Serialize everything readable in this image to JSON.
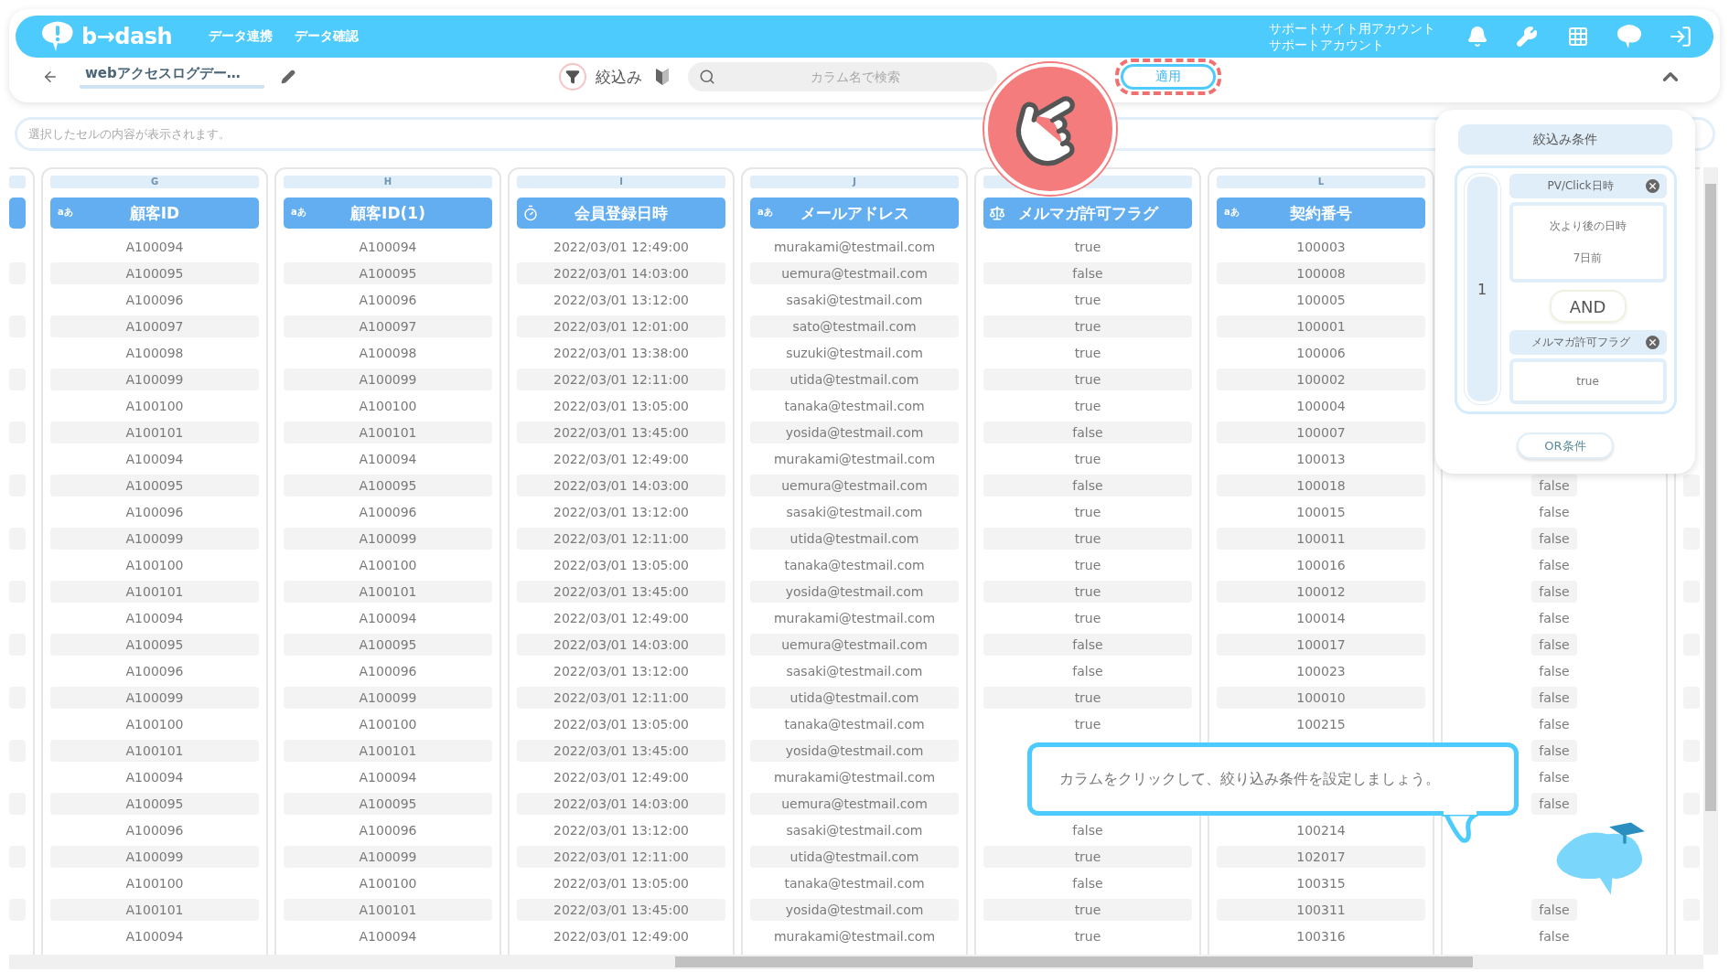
{
  "header": {
    "logo": "b→dash",
    "nav": [
      "データ連携",
      "データ確認"
    ],
    "account": [
      "サポートサイト用アカウント",
      "サポートアカウント"
    ]
  },
  "toolbar": {
    "title": "webアクセスログデー…",
    "filter_label": "絞込み",
    "search": {
      "placeholder": "カラム名で検索"
    },
    "apply_button": "適用"
  },
  "cell_viewer": {
    "placeholder": "選択したセルの内容が表示されます。"
  },
  "table": {
    "columns": [
      {
        "letter": "G",
        "kind": "text",
        "type_label": "aあ",
        "title": "顧客ID",
        "cells": [
          "A100094",
          "A100095",
          "A100096",
          "A100097",
          "A100098",
          "A100099",
          "A100100",
          "A100101",
          "A100094",
          "A100095",
          "A100096",
          "A100099",
          "A100100",
          "A100101",
          "A100094",
          "A100095",
          "A100096",
          "A100099",
          "A100100",
          "A100101",
          "A100094",
          "A100095",
          "A100096",
          "A100099",
          "A100100",
          "A100101",
          "A100094"
        ]
      },
      {
        "letter": "H",
        "kind": "text",
        "type_label": "aあ",
        "title": "顧客ID(1)",
        "cells": [
          "A100094",
          "A100095",
          "A100096",
          "A100097",
          "A100098",
          "A100099",
          "A100100",
          "A100101",
          "A100094",
          "A100095",
          "A100096",
          "A100099",
          "A100100",
          "A100101",
          "A100094",
          "A100095",
          "A100096",
          "A100099",
          "A100100",
          "A100101",
          "A100094",
          "A100095",
          "A100096",
          "A100099",
          "A100100",
          "A100101",
          "A100094"
        ]
      },
      {
        "letter": "I",
        "kind": "datetime",
        "title": "会員登録日時",
        "cells": [
          "2022/03/01 12:49:00",
          "2022/03/01 14:03:00",
          "2022/03/01 13:12:00",
          "2022/03/01 12:01:00",
          "2022/03/01 13:38:00",
          "2022/03/01 12:11:00",
          "2022/03/01 13:05:00",
          "2022/03/01 13:45:00",
          "2022/03/01 12:49:00",
          "2022/03/01 14:03:00",
          "2022/03/01 13:12:00",
          "2022/03/01 12:11:00",
          "2022/03/01 13:05:00",
          "2022/03/01 13:45:00",
          "2022/03/01 12:49:00",
          "2022/03/01 14:03:00",
          "2022/03/01 13:12:00",
          "2022/03/01 12:11:00",
          "2022/03/01 13:05:00",
          "2022/03/01 13:45:00",
          "2022/03/01 12:49:00",
          "2022/03/01 14:03:00",
          "2022/03/01 13:12:00",
          "2022/03/01 12:11:00",
          "2022/03/01 13:05:00",
          "2022/03/01 13:45:00",
          "2022/03/01 12:49:00"
        ]
      },
      {
        "letter": "J",
        "kind": "text",
        "type_label": "aあ",
        "title": "メールアドレス",
        "cells": [
          "murakami@testmail.com",
          "uemura@testmail.com",
          "sasaki@testmail.com",
          "sato@testmail.com",
          "suzuki@testmail.com",
          "utida@testmail.com",
          "tanaka@testmail.com",
          "yosida@testmail.com",
          "murakami@testmail.com",
          "uemura@testmail.com",
          "sasaki@testmail.com",
          "utida@testmail.com",
          "tanaka@testmail.com",
          "yosida@testmail.com",
          "murakami@testmail.com",
          "uemura@testmail.com",
          "sasaki@testmail.com",
          "utida@testmail.com",
          "tanaka@testmail.com",
          "yosida@testmail.com",
          "murakami@testmail.com",
          "uemura@testmail.com",
          "sasaki@testmail.com",
          "utida@testmail.com",
          "tanaka@testmail.com",
          "yosida@testmail.com",
          "murakami@testmail.com"
        ]
      },
      {
        "kind": "boolean",
        "title": "メルマガ許可フラグ",
        "cells": [
          "true",
          "false",
          "true",
          "true",
          "true",
          "true",
          "true",
          "false",
          "true",
          "false",
          "true",
          "true",
          "true",
          "true",
          "true",
          "false",
          "false",
          "true",
          "true",
          null,
          null,
          null,
          "false",
          "true",
          "false",
          "true",
          "true"
        ]
      },
      {
        "letter": "L",
        "kind": "text",
        "type_label": "aあ",
        "title": "契約番号",
        "cells": [
          "100003",
          "100008",
          "100005",
          "100001",
          "100006",
          "100002",
          "100004",
          "100007",
          "100013",
          "100018",
          "100015",
          "100011",
          "100016",
          "100012",
          "100014",
          "100017",
          "100023",
          "100010",
          "100215",
          null,
          null,
          null,
          "100214",
          "102017",
          "100315",
          "100311",
          "100316"
        ]
      },
      {
        "cells": [
          null,
          null,
          null,
          null,
          null,
          null,
          null,
          null,
          null,
          "false",
          "false",
          "false",
          "false",
          "false",
          "false",
          "false",
          "false",
          "false",
          "false",
          "false",
          "false",
          "false",
          null,
          null,
          null,
          "false",
          "false"
        ]
      }
    ]
  },
  "filter_panel": {
    "title": "絞込み条件",
    "groups": [
      {
        "number": "1",
        "joiner": "AND",
        "conditions": [
          {
            "field": "PV/Click日時",
            "values": [
              "次より後の日時",
              "7日前"
            ]
          },
          {
            "field": "メルマガ許可フラグ",
            "values": [
              "true"
            ]
          }
        ]
      }
    ],
    "or_button": "OR条件"
  },
  "tip": {
    "message": "カラムをクリックして、絞り込み条件を設定しましょう。"
  }
}
